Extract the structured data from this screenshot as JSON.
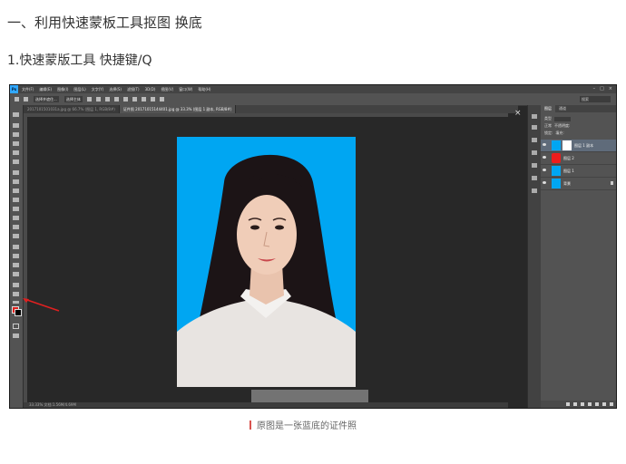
{
  "article": {
    "heading1": "一、利用快速蒙板工具抠图 换底",
    "heading2": "1.快速蒙版工具 快捷键/Q",
    "caption": "原图是一张蓝底的证件照"
  },
  "photoshop": {
    "logo": "Ps",
    "menu": [
      "文件(F)",
      "编辑(E)",
      "图像(I)",
      "图层(L)",
      "文字(Y)",
      "选择(S)",
      "滤镜(T)",
      "3D(D)",
      "视图(V)",
      "窗口(W)",
      "帮助(H)"
    ],
    "options": {
      "btn1": "选择并遮住...",
      "btn2": "选择主体",
      "search_placeholder": "搜索"
    },
    "tabs": [
      {
        "label": "2017101501031a.jpg @ 66.7% (图层 1, RGB/8#)",
        "active": false
      },
      {
        "label": "证件照 20171015144401.jpg @ 33.3% (图层 1 副本, RGB/8#)",
        "active": true
      }
    ],
    "statusbar": "33.33%    文档:1.56M/4.69M",
    "layers_panel": {
      "tab_layers": "图层",
      "tab_channels": "通道",
      "kind_label": "类型",
      "mode_label": "正常",
      "opacity_label": "不透明度:",
      "lock_label": "锁定:",
      "fill_label": "填充:",
      "layers": [
        {
          "name": "图层 1 副本",
          "selected": true,
          "type": "photo-mask"
        },
        {
          "name": "图层 2",
          "selected": false,
          "type": "fill",
          "color": "#ee1c1c"
        },
        {
          "name": "图层 1",
          "selected": false,
          "type": "photo"
        },
        {
          "name": "背景",
          "selected": false,
          "type": "photo-locked"
        }
      ]
    },
    "colors": {
      "foreground": "#e0201c",
      "background": "#000000",
      "photo_bg": "#00a6f2"
    }
  }
}
